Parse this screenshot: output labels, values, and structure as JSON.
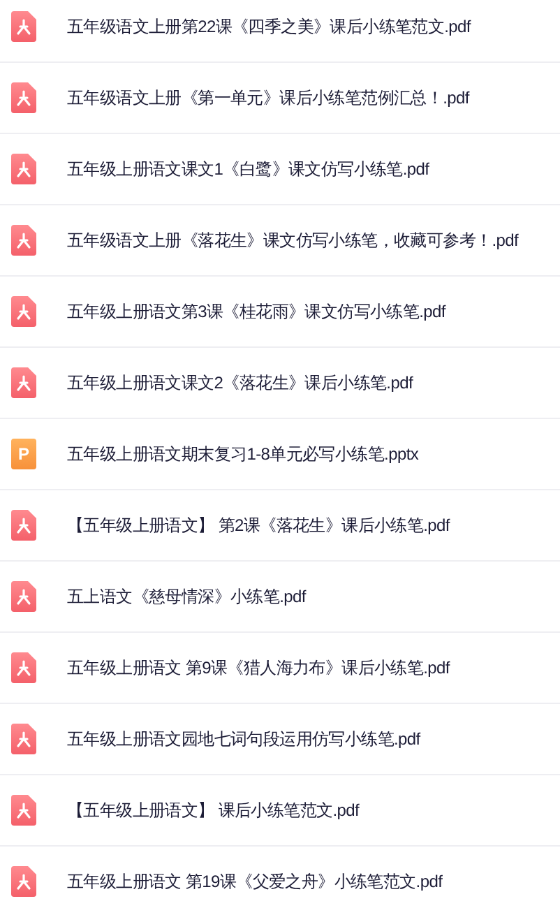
{
  "files": [
    {
      "kind": "pdf",
      "name": "五年级语文上册第22课《四季之美》课后小练笔范文.pdf"
    },
    {
      "kind": "pdf",
      "name": "五年级语文上册《第一单元》课后小练笔范例汇总！.pdf"
    },
    {
      "kind": "pdf",
      "name": "五年级上册语文课文1《白鹭》课文仿写小练笔.pdf"
    },
    {
      "kind": "pdf",
      "name": "五年级语文上册《落花生》课文仿写小练笔，收藏可参考！.pdf"
    },
    {
      "kind": "pdf",
      "name": "五年级上册语文第3课《桂花雨》课文仿写小练笔.pdf"
    },
    {
      "kind": "pdf",
      "name": "五年级上册语文课文2《落花生》课后小练笔.pdf"
    },
    {
      "kind": "pptx",
      "badge": "P",
      "name": "五年级上册语文期末复习1-8单元必写小练笔.pptx"
    },
    {
      "kind": "pdf",
      "name": "【五年级上册语文】 第2课《落花生》课后小练笔.pdf"
    },
    {
      "kind": "pdf",
      "name": "五上语文《慈母情深》小练笔.pdf"
    },
    {
      "kind": "pdf",
      "name": "五年级上册语文 第9课《猎人海力布》课后小练笔.pdf"
    },
    {
      "kind": "pdf",
      "name": "五年级上册语文园地七词句段运用仿写小练笔.pdf"
    },
    {
      "kind": "pdf",
      "name": "【五年级上册语文】 课后小练笔范文.pdf"
    },
    {
      "kind": "pdf",
      "name": "五年级上册语文 第19课《父爱之舟》小练笔范文.pdf"
    }
  ]
}
